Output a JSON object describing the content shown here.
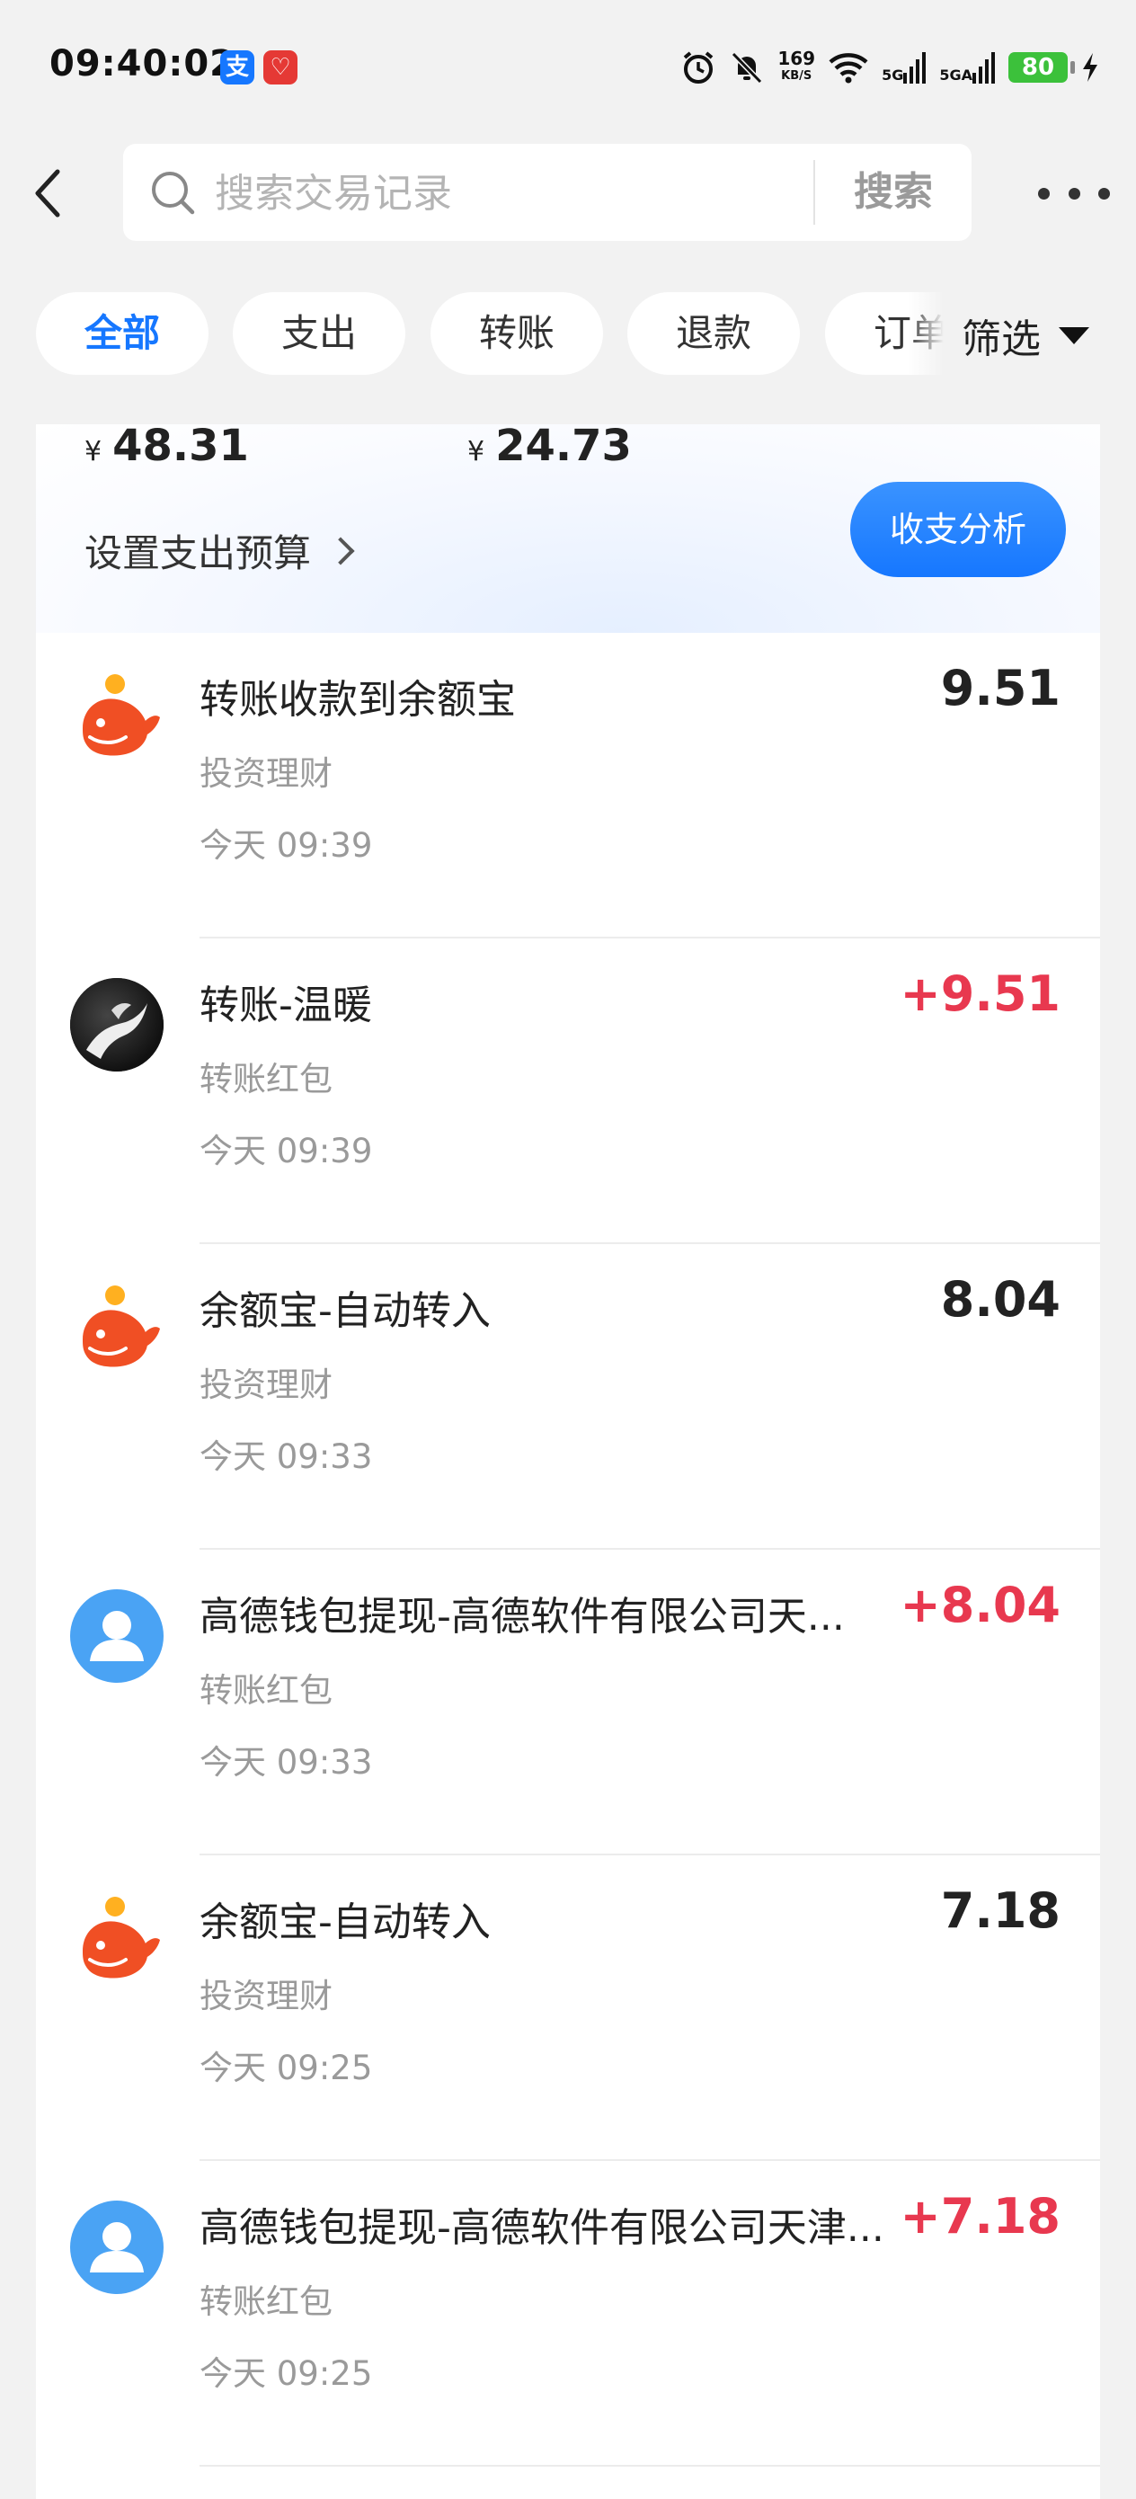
{
  "status_bar": {
    "time": "09:40:02",
    "app_badges": [
      "支",
      "♡"
    ],
    "net_speed_value": "169",
    "net_speed_unit": "KB/S",
    "signal1_label": "5G",
    "signal2_label": "5GA",
    "battery": "80",
    "icons": [
      "alarm-icon",
      "mute-icon",
      "wifi-icon",
      "signal-icon",
      "charging-icon"
    ]
  },
  "search": {
    "placeholder": "搜索交易记录",
    "button_label": "搜索"
  },
  "filters": {
    "chips": [
      "全部",
      "支出",
      "转账",
      "退款",
      "订单"
    ],
    "active_index": 0,
    "filter_label": "筛选"
  },
  "summary": {
    "value_left": "48.31",
    "value_right": "24.73",
    "currency": "¥",
    "budget_link": "设置支出预算",
    "analysis_button": "收支分析"
  },
  "colors": {
    "accent": "#1677ff",
    "income": "#e8384f",
    "neutral_amount": "#222222",
    "yuebao_orange": "#f04f24"
  },
  "transactions": [
    {
      "title": "转账收款到余额宝",
      "category": "投资理财",
      "time": "今天 09:39",
      "amount": "9.51",
      "amount_type": "neutral",
      "icon": "yuebao-icon"
    },
    {
      "title": "转账-温暖",
      "category": "转账红包",
      "time": "今天 09:39",
      "amount": "+9.51",
      "amount_type": "income",
      "icon": "user-avatar"
    },
    {
      "title": "余额宝-自动转入",
      "category": "投资理财",
      "time": "今天 09:33",
      "amount": "8.04",
      "amount_type": "neutral",
      "icon": "yuebao-icon"
    },
    {
      "title": "高德钱包提现-高德软件有限公司天...",
      "category": "转账红包",
      "time": "今天 09:33",
      "amount": "+8.04",
      "amount_type": "income",
      "icon": "person-icon"
    },
    {
      "title": "余额宝-自动转入",
      "category": "投资理财",
      "time": "今天 09:25",
      "amount": "7.18",
      "amount_type": "neutral",
      "icon": "yuebao-icon"
    },
    {
      "title": "高德钱包提现-高德软件有限公司天津...",
      "category": "转账红包",
      "time": "今天 09:25",
      "amount": "+7.18",
      "amount_type": "income",
      "icon": "person-icon"
    }
  ]
}
